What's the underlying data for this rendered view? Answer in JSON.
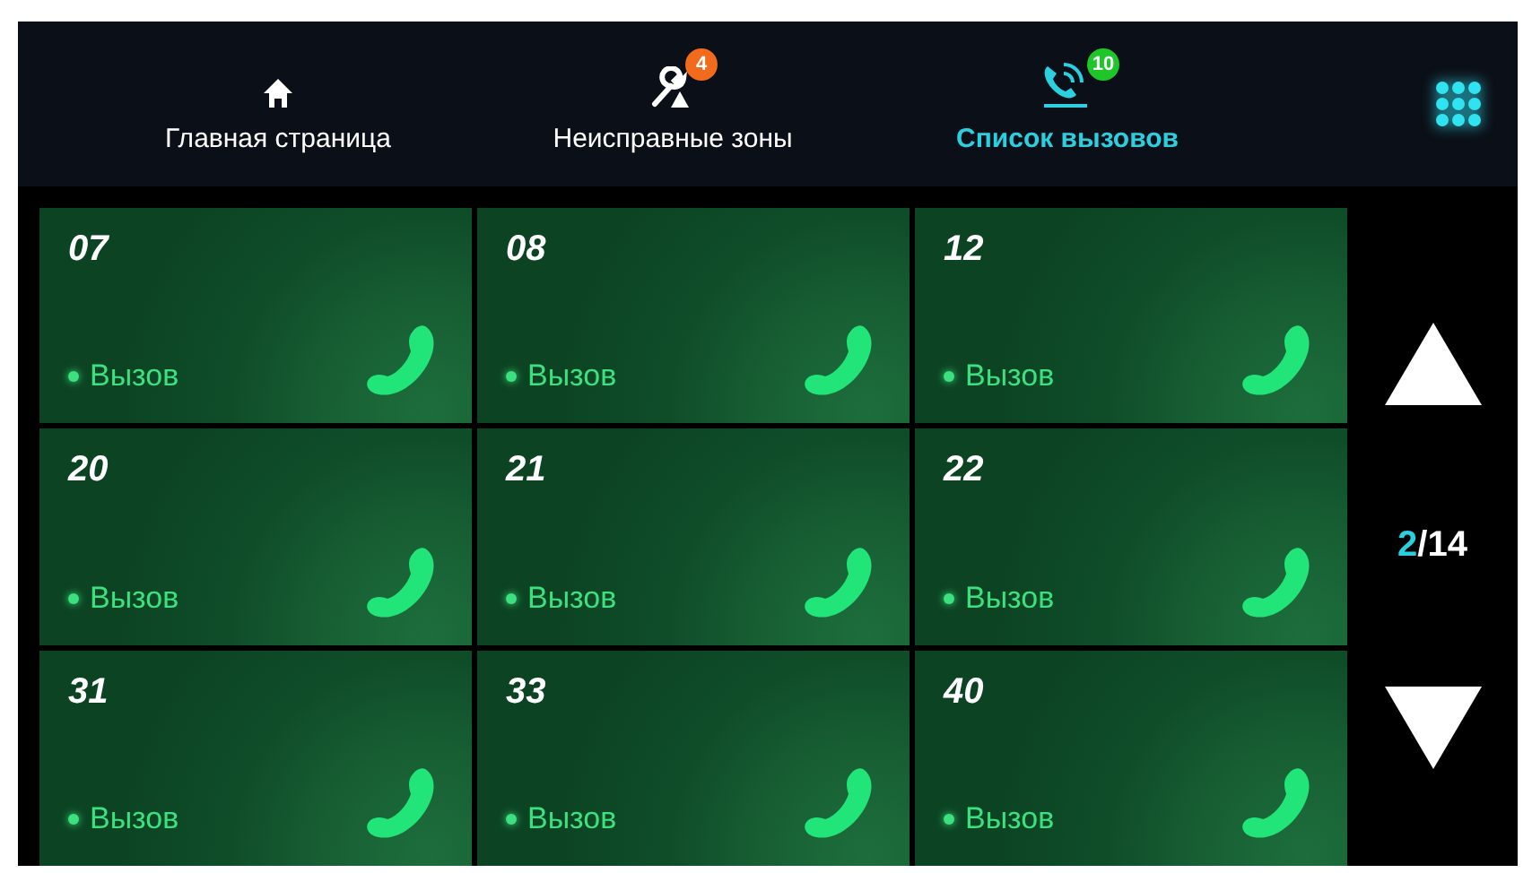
{
  "tabs": [
    {
      "kind": "home",
      "label": "Главная страница",
      "selected": false
    },
    {
      "kind": "fault",
      "label": "Неисправные зоны",
      "selected": false,
      "badge": "4",
      "color": "#f26a1b"
    },
    {
      "kind": "calls",
      "label": "Список вызовов",
      "selected": true,
      "badge": "10",
      "color": "#1fc62a"
    }
  ],
  "calls": [
    {
      "number": "07",
      "status": "Вызов"
    },
    {
      "number": "08",
      "status": "Вызов"
    },
    {
      "number": "12",
      "status": "Вызов"
    },
    {
      "number": "20",
      "status": "Вызов"
    },
    {
      "number": "21",
      "status": "Вызов"
    },
    {
      "number": "22",
      "status": "Вызов"
    },
    {
      "number": "31",
      "status": "Вызов"
    },
    {
      "number": "33",
      "status": "Вызов"
    },
    {
      "number": "40",
      "status": "Вызов"
    }
  ],
  "pager": {
    "current": "2",
    "total": "/14"
  }
}
